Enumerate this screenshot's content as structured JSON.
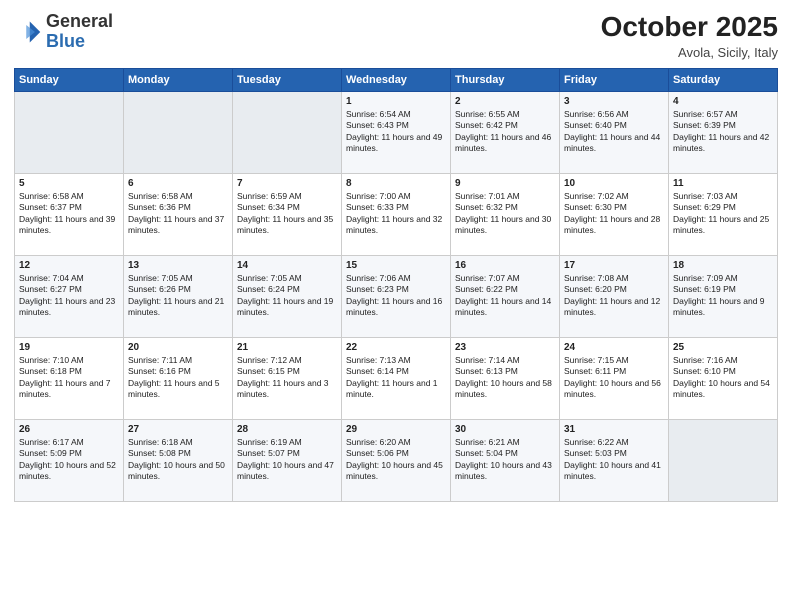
{
  "logo": {
    "general": "General",
    "blue": "Blue"
  },
  "header": {
    "month": "October 2025",
    "location": "Avola, Sicily, Italy"
  },
  "days_of_week": [
    "Sunday",
    "Monday",
    "Tuesday",
    "Wednesday",
    "Thursday",
    "Friday",
    "Saturday"
  ],
  "weeks": [
    [
      {
        "day": "",
        "data": ""
      },
      {
        "day": "",
        "data": ""
      },
      {
        "day": "",
        "data": ""
      },
      {
        "day": "1",
        "data": "Sunrise: 6:54 AM\nSunset: 6:43 PM\nDaylight: 11 hours and 49 minutes."
      },
      {
        "day": "2",
        "data": "Sunrise: 6:55 AM\nSunset: 6:42 PM\nDaylight: 11 hours and 46 minutes."
      },
      {
        "day": "3",
        "data": "Sunrise: 6:56 AM\nSunset: 6:40 PM\nDaylight: 11 hours and 44 minutes."
      },
      {
        "day": "4",
        "data": "Sunrise: 6:57 AM\nSunset: 6:39 PM\nDaylight: 11 hours and 42 minutes."
      }
    ],
    [
      {
        "day": "5",
        "data": "Sunrise: 6:58 AM\nSunset: 6:37 PM\nDaylight: 11 hours and 39 minutes."
      },
      {
        "day": "6",
        "data": "Sunrise: 6:58 AM\nSunset: 6:36 PM\nDaylight: 11 hours and 37 minutes."
      },
      {
        "day": "7",
        "data": "Sunrise: 6:59 AM\nSunset: 6:34 PM\nDaylight: 11 hours and 35 minutes."
      },
      {
        "day": "8",
        "data": "Sunrise: 7:00 AM\nSunset: 6:33 PM\nDaylight: 11 hours and 32 minutes."
      },
      {
        "day": "9",
        "data": "Sunrise: 7:01 AM\nSunset: 6:32 PM\nDaylight: 11 hours and 30 minutes."
      },
      {
        "day": "10",
        "data": "Sunrise: 7:02 AM\nSunset: 6:30 PM\nDaylight: 11 hours and 28 minutes."
      },
      {
        "day": "11",
        "data": "Sunrise: 7:03 AM\nSunset: 6:29 PM\nDaylight: 11 hours and 25 minutes."
      }
    ],
    [
      {
        "day": "12",
        "data": "Sunrise: 7:04 AM\nSunset: 6:27 PM\nDaylight: 11 hours and 23 minutes."
      },
      {
        "day": "13",
        "data": "Sunrise: 7:05 AM\nSunset: 6:26 PM\nDaylight: 11 hours and 21 minutes."
      },
      {
        "day": "14",
        "data": "Sunrise: 7:05 AM\nSunset: 6:24 PM\nDaylight: 11 hours and 19 minutes."
      },
      {
        "day": "15",
        "data": "Sunrise: 7:06 AM\nSunset: 6:23 PM\nDaylight: 11 hours and 16 minutes."
      },
      {
        "day": "16",
        "data": "Sunrise: 7:07 AM\nSunset: 6:22 PM\nDaylight: 11 hours and 14 minutes."
      },
      {
        "day": "17",
        "data": "Sunrise: 7:08 AM\nSunset: 6:20 PM\nDaylight: 11 hours and 12 minutes."
      },
      {
        "day": "18",
        "data": "Sunrise: 7:09 AM\nSunset: 6:19 PM\nDaylight: 11 hours and 9 minutes."
      }
    ],
    [
      {
        "day": "19",
        "data": "Sunrise: 7:10 AM\nSunset: 6:18 PM\nDaylight: 11 hours and 7 minutes."
      },
      {
        "day": "20",
        "data": "Sunrise: 7:11 AM\nSunset: 6:16 PM\nDaylight: 11 hours and 5 minutes."
      },
      {
        "day": "21",
        "data": "Sunrise: 7:12 AM\nSunset: 6:15 PM\nDaylight: 11 hours and 3 minutes."
      },
      {
        "day": "22",
        "data": "Sunrise: 7:13 AM\nSunset: 6:14 PM\nDaylight: 11 hours and 1 minute."
      },
      {
        "day": "23",
        "data": "Sunrise: 7:14 AM\nSunset: 6:13 PM\nDaylight: 10 hours and 58 minutes."
      },
      {
        "day": "24",
        "data": "Sunrise: 7:15 AM\nSunset: 6:11 PM\nDaylight: 10 hours and 56 minutes."
      },
      {
        "day": "25",
        "data": "Sunrise: 7:16 AM\nSunset: 6:10 PM\nDaylight: 10 hours and 54 minutes."
      }
    ],
    [
      {
        "day": "26",
        "data": "Sunrise: 6:17 AM\nSunset: 5:09 PM\nDaylight: 10 hours and 52 minutes."
      },
      {
        "day": "27",
        "data": "Sunrise: 6:18 AM\nSunset: 5:08 PM\nDaylight: 10 hours and 50 minutes."
      },
      {
        "day": "28",
        "data": "Sunrise: 6:19 AM\nSunset: 5:07 PM\nDaylight: 10 hours and 47 minutes."
      },
      {
        "day": "29",
        "data": "Sunrise: 6:20 AM\nSunset: 5:06 PM\nDaylight: 10 hours and 45 minutes."
      },
      {
        "day": "30",
        "data": "Sunrise: 6:21 AM\nSunset: 5:04 PM\nDaylight: 10 hours and 43 minutes."
      },
      {
        "day": "31",
        "data": "Sunrise: 6:22 AM\nSunset: 5:03 PM\nDaylight: 10 hours and 41 minutes."
      },
      {
        "day": "",
        "data": ""
      }
    ]
  ]
}
